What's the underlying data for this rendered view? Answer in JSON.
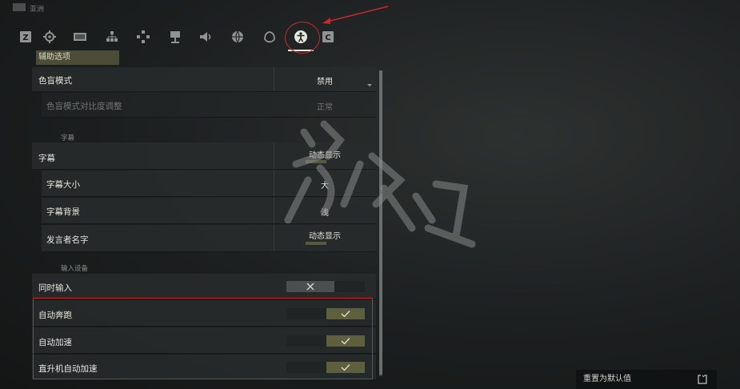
{
  "app": {
    "title": "亚洲"
  },
  "tabs": [
    {
      "icon": "z-key-icon",
      "active": false
    },
    {
      "icon": "gear-icon",
      "active": false
    },
    {
      "icon": "display-icon",
      "active": false
    },
    {
      "icon": "graphics-icon",
      "active": false
    },
    {
      "icon": "gamepad-icon",
      "active": false
    },
    {
      "icon": "network-icon",
      "active": false
    },
    {
      "icon": "speaker-icon",
      "active": false
    },
    {
      "icon": "globe-icon",
      "active": false
    },
    {
      "icon": "social-icon",
      "active": false
    },
    {
      "icon": "accessibility-icon",
      "active": true
    },
    {
      "icon": "c-key-icon",
      "active": false
    }
  ],
  "section": {
    "title": "辅助选项"
  },
  "color_blind": {
    "mode_label": "色盲模式",
    "mode_value": "禁用",
    "contrast_label": "色盲模式对比度调整",
    "contrast_value": "正常"
  },
  "subtitles": {
    "group_title": "字幕",
    "main_label": "字幕",
    "main_value": "动态显示",
    "size_label": "字幕大小",
    "size_value": "大",
    "bg_label": "字幕背景",
    "bg_value": "浅",
    "speaker_label": "发言者名字",
    "speaker_value": "动态显示"
  },
  "input": {
    "group_title": "输入设备",
    "simultaneous_label": "同时输入",
    "simultaneous_on": false,
    "auto_run_label": "自动奔跑",
    "auto_run_on": true,
    "auto_accel_label": "自动加速",
    "auto_accel_on": true,
    "heli_auto_accel_label": "直升机自动加速",
    "heli_auto_accel_on": true
  },
  "footer": {
    "reset_label": "重置为默认值"
  },
  "colors": {
    "accent": "#5e5f3d",
    "annotation": "#c6282c",
    "panel_bg": "#282c2c"
  }
}
